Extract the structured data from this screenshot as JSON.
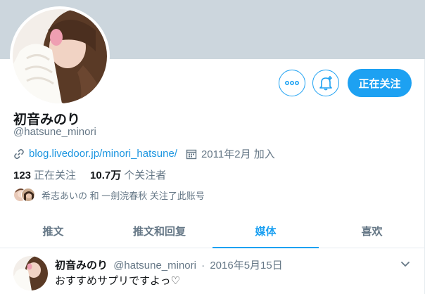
{
  "profile": {
    "display_name": "初音みのり",
    "handle": "@hatsune_minori",
    "link": "blog.livedoor.jp/minori_hatsune/",
    "joined": "2011年2月 加入",
    "following_count": "123",
    "following_label": "正在关注",
    "followers_count": "10.7万",
    "followers_label": "个关注者",
    "followed_by": "希志あいの 和 一劍浣春秋 关注了此账号"
  },
  "actions": {
    "following_button": "正在关注"
  },
  "tabs": [
    {
      "label": "推文",
      "active": false
    },
    {
      "label": "推文和回复",
      "active": false
    },
    {
      "label": "媒体",
      "active": true
    },
    {
      "label": "喜欢",
      "active": false
    }
  ],
  "tweet": {
    "name": "初音みのり",
    "handle": "@hatsune_minori",
    "separator": "·",
    "date": "2016年5月15日",
    "text": "おすすめサプリですよっ♡"
  },
  "colors": {
    "accent": "#1da1f2",
    "banner": "#ccd6dd",
    "secondary_text": "#657786"
  }
}
